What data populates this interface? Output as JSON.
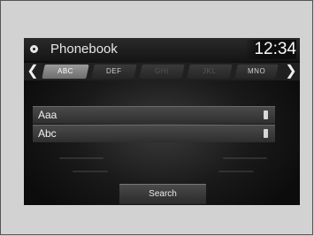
{
  "header": {
    "title": "Phonebook",
    "time": "12:34",
    "home_icon": "home-icon"
  },
  "tabs": [
    {
      "label": "ABC",
      "state": "active"
    },
    {
      "label": "DEF",
      "state": "enabled"
    },
    {
      "label": "GHI",
      "state": "disabled"
    },
    {
      "label": "JKL",
      "state": "disabled"
    },
    {
      "label": "MNO",
      "state": "enabled"
    }
  ],
  "entries": [
    {
      "name": "Aaa",
      "icon": "phone-icon"
    },
    {
      "name": "Abc",
      "icon": "phone-icon"
    }
  ],
  "search_label": "Search",
  "colors": {
    "screen_bg": "#0c0c0c",
    "active_tab": "#8a8a8a",
    "text": "#f2f2f2"
  }
}
